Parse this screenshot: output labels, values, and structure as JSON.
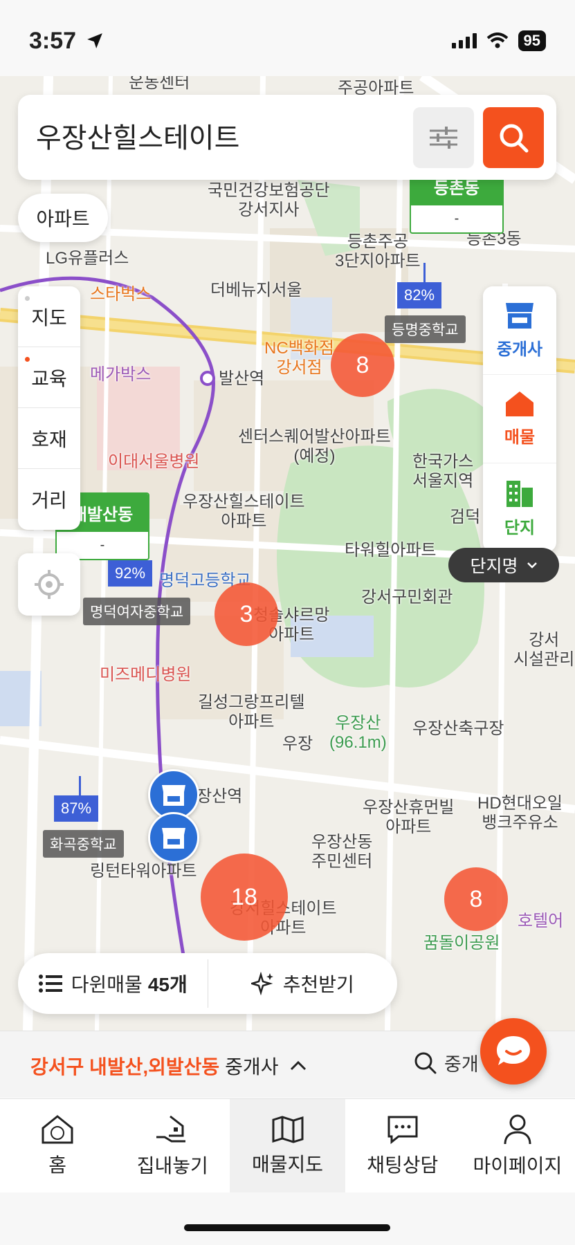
{
  "status": {
    "time": "3:57",
    "battery": "95"
  },
  "search": {
    "query": "우장산힐스테이트"
  },
  "type_chip": "아파트",
  "layers": [
    {
      "label": "지도",
      "dot_color": "#cccccc"
    },
    {
      "label": "교육",
      "dot_color": "#f4511e"
    },
    {
      "label": "호재",
      "dot_color": ""
    },
    {
      "label": "거리",
      "dot_color": ""
    }
  ],
  "right_menu": [
    {
      "label": "중개사",
      "icon": "store-icon",
      "color": "#2b6fd6"
    },
    {
      "label": "매물",
      "icon": "house-icon",
      "color": "#f4511e"
    },
    {
      "label": "단지",
      "icon": "building-icon",
      "color": "#3daa3d"
    }
  ],
  "danji_select": "단지명",
  "map_labels": {
    "undong": "운동센터",
    "jugong_top": "주공아파트",
    "nhis": "국민건강보험공단\n강서지사",
    "lgu": "LG유플러스",
    "deungchon_jugong": "등촌주공\n3단지아파트",
    "deungchon3": "등촌3동",
    "starbucks": "스타벅스",
    "thevenue": "더베뉴지서울",
    "nc": "NC백화점\n강서점",
    "megabox": "메가박스",
    "balsan_stn": "발산역",
    "center_square": "센터스퀘어발산아파트\n(예정)",
    "kogas": "한국가스\n서울지역",
    "ewha": "이대서울병원",
    "woojang_hillstate1": "우장산힐스테이트\n아파트",
    "geomdeok": "검덕",
    "tower_hill": "타워힐아파트",
    "gangseo_hall": "강서구민회관",
    "chungsol": "청솔샤르망\n아파트",
    "mizmedi": "미즈메디병원",
    "gilsung": "길성그랑프리텔\n아파트",
    "woojangsan_peak": "우장산\n(96.1m)",
    "woojang_soccer": "우장산축구장",
    "hd_bank": "HD현대오일\n뱅크주유소",
    "woojang_station": "우장산역",
    "humanvil": "우장산휴먼빌\n아파트",
    "community_center": "우장산동\n주민센터",
    "hillstate2": "강서힐스테이트\n아파트",
    "kkumdol": "꿈돌이공원",
    "hotel": "호텔어",
    "gangseo_facility": "강서\n시설관리",
    "myungduk_high": "명덕고등학교",
    "hwagok_label": "화곡중학교",
    "rington": "링턴타워아파트",
    "woojang_left": "우장"
  },
  "dong_cards": [
    {
      "name": "내발산동",
      "value": "-"
    },
    {
      "name": "등촌동",
      "value": "-"
    }
  ],
  "schools": [
    {
      "name": "등명중학교",
      "pct": "82%"
    },
    {
      "name": "명덕여자중학교",
      "pct": "92%"
    },
    {
      "name": "화곡중학교",
      "pct": "87%"
    }
  ],
  "clusters": [
    {
      "count": "8"
    },
    {
      "count": "3"
    },
    {
      "count": "18"
    },
    {
      "count": "8"
    }
  ],
  "bottom_actions": {
    "listings_label": "다윈매물",
    "listings_count": "45개",
    "recommend_label": "추천받기"
  },
  "region": {
    "name": "강서구 내발산,외발산동",
    "suffix": "중개사",
    "search_label": "중개"
  },
  "tabs": [
    {
      "label": "홈",
      "icon": "home-icon",
      "active": false
    },
    {
      "label": "집내놓기",
      "icon": "house-hand-icon",
      "active": false
    },
    {
      "label": "매물지도",
      "icon": "map-icon",
      "active": true
    },
    {
      "label": "채팅상담",
      "icon": "chat-icon",
      "active": false
    },
    {
      "label": "마이페이지",
      "icon": "person-icon",
      "active": false
    }
  ],
  "colors": {
    "accent": "#f4511e",
    "blue": "#2b6fd6",
    "green": "#3daa3d",
    "cluster": "#f45634"
  }
}
